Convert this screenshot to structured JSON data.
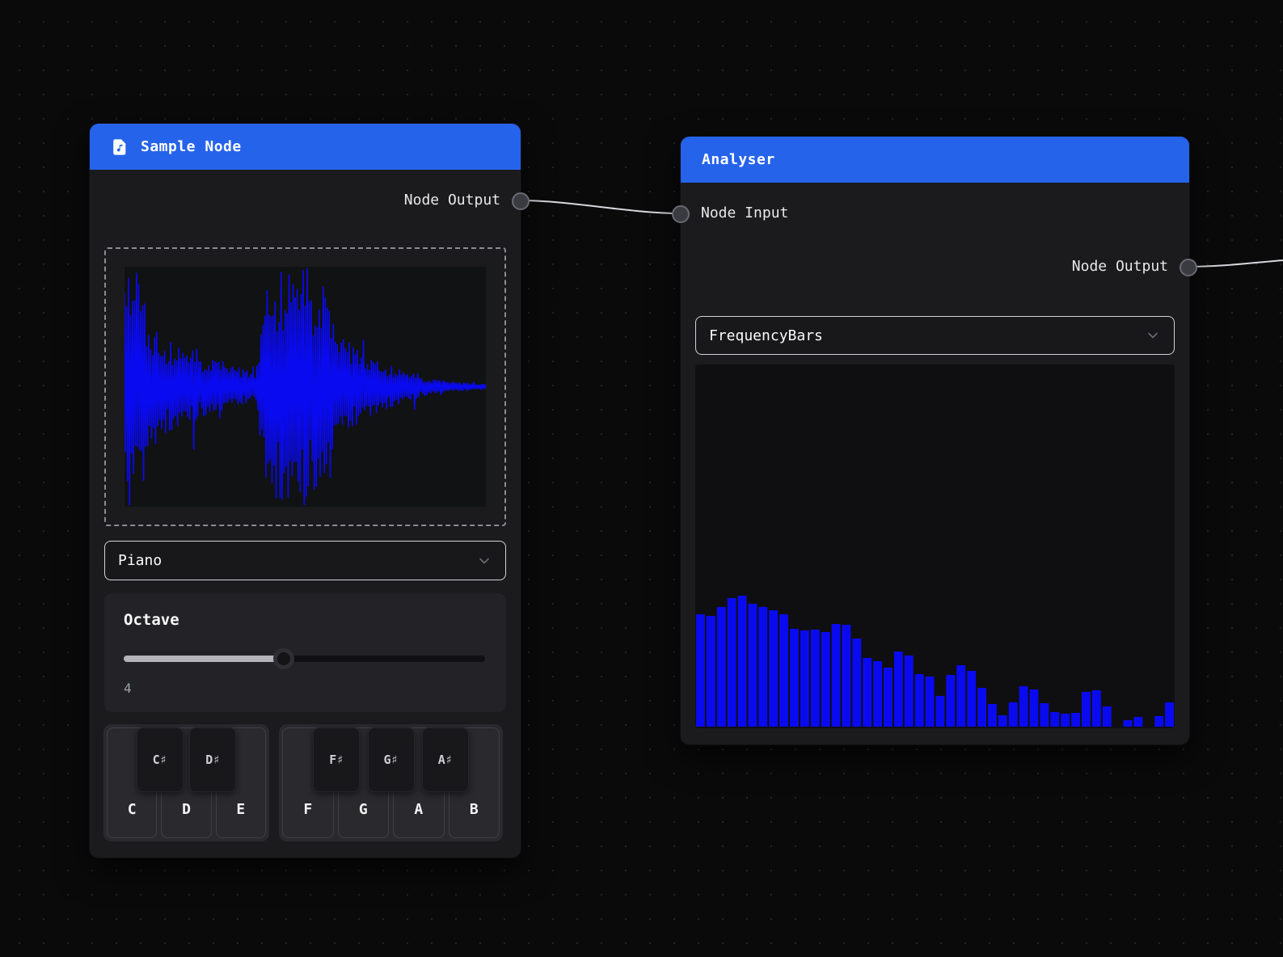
{
  "colors": {
    "accent_blue": "#2563eb",
    "viz_blue": "#0a0af0",
    "wire": "#d8d8dc",
    "background": "#0a0a0b"
  },
  "sample_node": {
    "title": "Sample Node",
    "header_icon": "file-music-icon",
    "output_port_label": "Node Output",
    "instrument_select": {
      "value": "Piano"
    },
    "octave": {
      "label": "Octave",
      "value": "4",
      "slider_percent": 44
    },
    "keyboard": {
      "groups": [
        {
          "white_keys": [
            "C",
            "D",
            "E"
          ],
          "black_keys": [
            "C♯",
            "D♯"
          ]
        },
        {
          "white_keys": [
            "F",
            "G",
            "A",
            "B"
          ],
          "black_keys": [
            "F♯",
            "G♯",
            "A♯"
          ]
        }
      ]
    }
  },
  "analyser_node": {
    "title": "Analyser",
    "input_port_label": "Node Input",
    "output_port_label": "Node Output",
    "mode_select": {
      "value": "FrequencyBars"
    }
  },
  "chart_data": [
    {
      "type": "line",
      "title": "sample-waveform",
      "description": "decaying audio waveform with two bursts",
      "x_range": [
        0,
        1
      ],
      "y_range": [
        -1,
        1
      ],
      "envelope": [
        [
          0,
          1
        ],
        [
          0.045,
          1
        ],
        [
          0.06,
          0.62
        ],
        [
          0.1,
          0.42
        ],
        [
          0.16,
          0.33
        ],
        [
          0.24,
          0.26
        ],
        [
          0.3,
          0.18
        ],
        [
          0.36,
          0.12
        ],
        [
          0.4,
          0.95
        ],
        [
          0.47,
          1
        ],
        [
          0.55,
          0.95
        ],
        [
          0.58,
          0.5
        ],
        [
          0.63,
          0.35
        ],
        [
          0.7,
          0.22
        ],
        [
          0.78,
          0.13
        ],
        [
          0.85,
          0.07
        ],
        [
          0.92,
          0.04
        ],
        [
          1,
          0.025
        ]
      ]
    },
    {
      "type": "bar",
      "title": "frequency-spectrum",
      "ylim": [
        0,
        450
      ],
      "values": [
        139,
        137,
        148,
        159,
        162,
        152,
        148,
        144,
        139,
        121,
        119,
        120,
        117,
        127,
        126,
        109,
        85,
        81,
        73,
        93,
        88,
        65,
        62,
        38,
        64,
        76,
        69,
        48,
        28,
        14,
        30,
        50,
        46,
        29,
        18,
        16,
        17,
        43,
        45,
        25,
        0,
        8,
        12,
        0,
        13,
        30
      ]
    }
  ]
}
